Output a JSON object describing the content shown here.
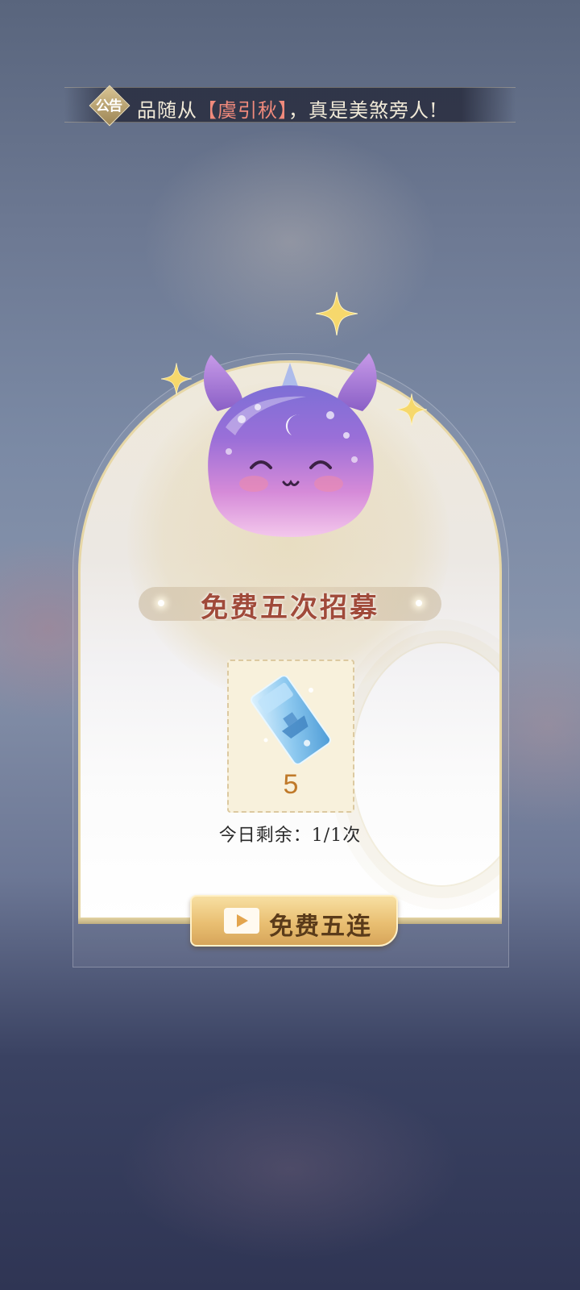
{
  "announcement": {
    "badge": "公告",
    "prefix": "品随从",
    "highlight": "【虞引秋】",
    "suffix": "，真是美煞旁人!"
  },
  "recruit": {
    "title": "免费五次招募",
    "item": {
      "icon": "ticket-icon",
      "count": "5"
    },
    "remaining": "今日剩余：1/1次",
    "button_label": "免费五连",
    "button_icon": "video-play-icon"
  },
  "colors": {
    "title": "#a04a3a",
    "highlight": "#f08a7c",
    "count": "#c07a2a",
    "button": "#e9bf72"
  }
}
